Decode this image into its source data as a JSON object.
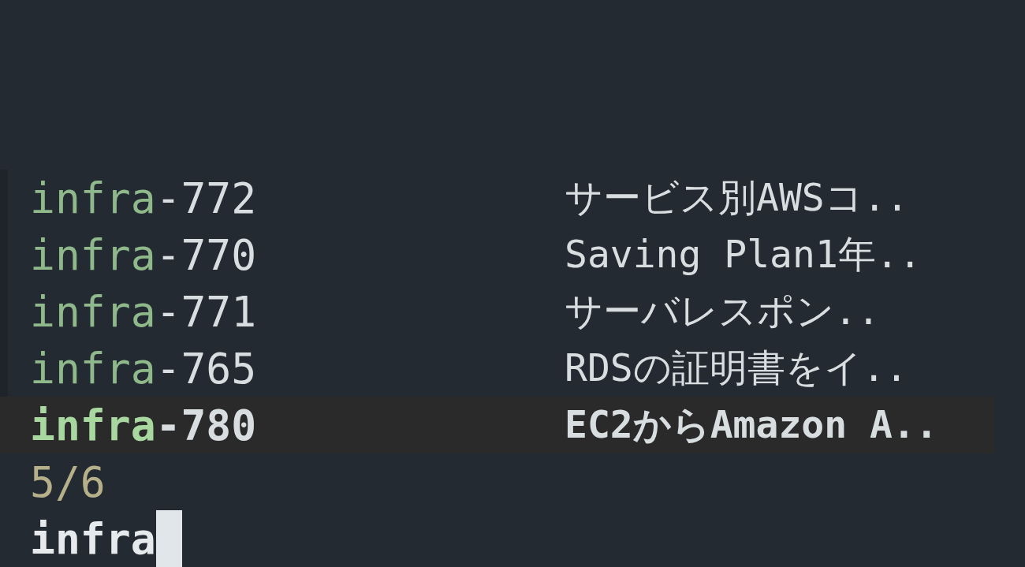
{
  "results": [
    {
      "id": "infra-772",
      "title": "サービス別AWSコ..",
      "selected": false
    },
    {
      "id": "infra-770",
      "title": "Saving Plan1年..",
      "selected": false
    },
    {
      "id": "infra-771",
      "title": "サーバレスポン..",
      "selected": false
    },
    {
      "id": "infra-765",
      "title": "RDSの証明書をイ..",
      "selected": false
    },
    {
      "id": "infra-780",
      "title": "EC2からAmazon A..",
      "selected": true
    }
  ],
  "match_count": "5/6",
  "query": "infra"
}
